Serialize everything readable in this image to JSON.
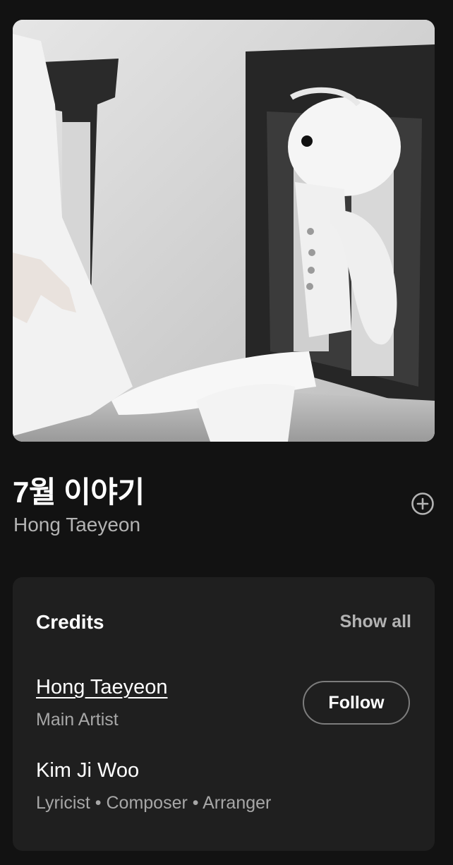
{
  "track": {
    "title": "7월 이야기",
    "artist": "Hong Taeyeon"
  },
  "icons": {
    "add": "plus-circle-icon"
  },
  "credits": {
    "heading": "Credits",
    "show_all_label": "Show all",
    "entries": [
      {
        "name": "Hong Taeyeon",
        "role": "Main Artist",
        "follow_label": "Follow"
      },
      {
        "name": "Kim Ji Woo",
        "role": "Lyricist • Composer • Arranger"
      }
    ]
  },
  "colors": {
    "background": "#121212",
    "card": "#1f1f1f",
    "primary_text": "#ffffff",
    "secondary_text": "#b3b3b3"
  }
}
